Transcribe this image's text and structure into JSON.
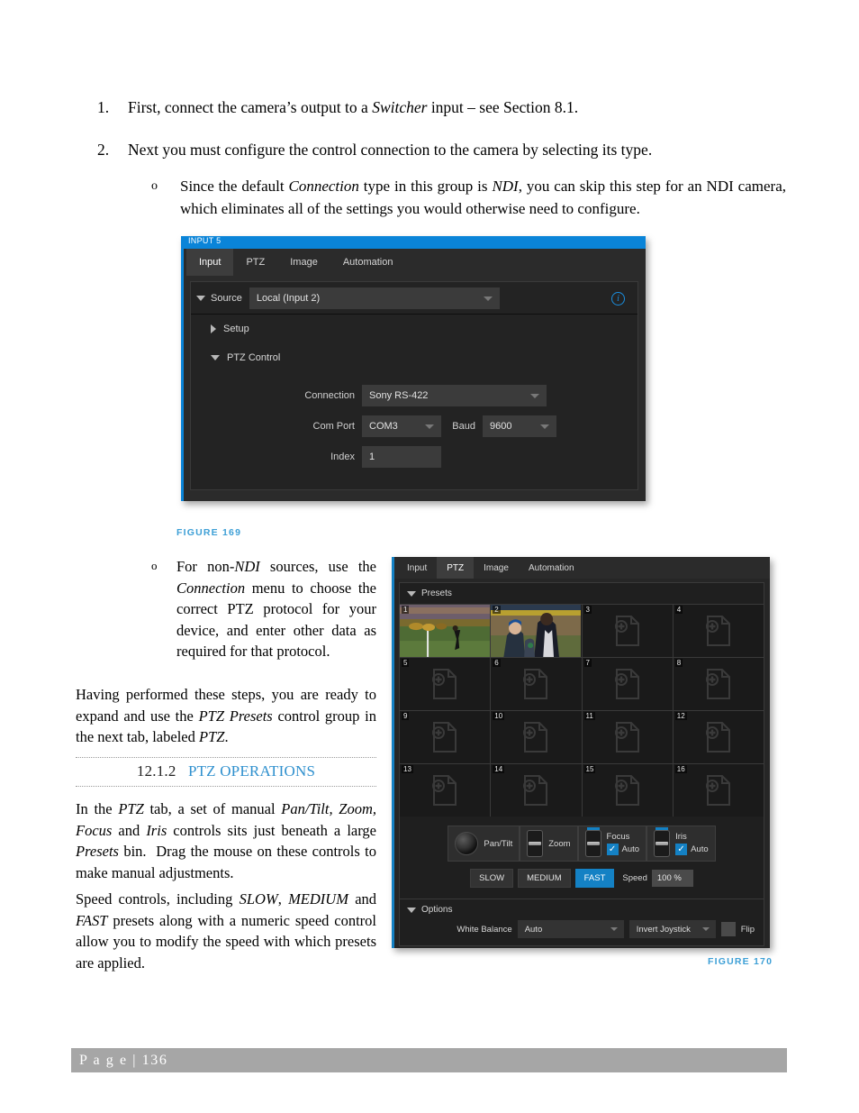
{
  "document": {
    "page_label": "P a g e  | 136",
    "steps": [
      {
        "marker": "1.",
        "text_html": "First, connect the camera’s output to a <em>Switcher</em> input – see Section 8.1."
      },
      {
        "marker": "2.",
        "text_html": "Next you must configure the control connection to the camera by selecting its type."
      }
    ],
    "bullet_1": {
      "marker": "o",
      "text_html": "Since the default <em>Connection</em> type in this group is <em>NDI</em>, you can skip this step for an NDI camera, which eliminates all of the settings you would otherwise need to configure."
    },
    "bullet_2": {
      "marker": "o",
      "text_html": "For non-<em>NDI</em> sources, use the <em>Connection</em> menu to choose the correct PTZ protocol for your device, and enter other data as required for that protocol."
    },
    "paragraphs": [
      {
        "id": "p_having",
        "text_html": "Having performed these steps, you are ready to expand and use the <em>PTZ Presets</em> control group in the next tab, labeled <em>PTZ</em>."
      },
      {
        "id": "p_inthe",
        "text_html": "In the <em>PTZ</em> tab, a set of manual <em>Pan/Tilt, Zoom, Focus</em> and <em>Iris</em> controls sits just beneath a large <em>Presets</em> bin.&nbsp; Drag the mouse on these controls to make manual adjustments."
      },
      {
        "id": "p_speed",
        "text_html": "Speed controls, including <em>SLOW</em>, <em>MEDIUM</em> and <em>FAST</em> presets along with a numeric speed control allow you to modify the speed with which presets are applied."
      }
    ],
    "section_heading": {
      "number": "12.1.2",
      "title": "PTZ OPERATIONS"
    },
    "captions": {
      "figure_169": "FIGURE 169",
      "figure_170": "FIGURE 170"
    }
  },
  "colors": {
    "accent_blue": "#1481c4",
    "titlebar_blue": "#0a84d8",
    "caption_blue": "#3d9fd6",
    "heading_blue": "#2f90ce",
    "panel_bg": "#2b2b2b",
    "footer_gray": "#a6a6a6"
  },
  "figure_169": {
    "window_title": "INPUT 5",
    "tabs": [
      {
        "label": "Input",
        "active": true
      },
      {
        "label": "PTZ",
        "active": false
      },
      {
        "label": "Image",
        "active": false
      },
      {
        "label": "Automation",
        "active": false
      }
    ],
    "source": {
      "label": "Source",
      "value": "Local (Input 2)"
    },
    "info_icon": "info-icon",
    "groups": [
      {
        "label": "Setup",
        "expanded": false
      },
      {
        "label": "PTZ Control",
        "expanded": true
      }
    ],
    "ptz_control": {
      "connection": {
        "label": "Connection",
        "value": "Sony RS-422"
      },
      "com_port": {
        "label": "Com Port",
        "value": "COM3"
      },
      "baud": {
        "label": "Baud",
        "value": "9600"
      },
      "index": {
        "label": "Index",
        "value": "1"
      }
    }
  },
  "figure_170": {
    "tabs": [
      {
        "label": "Input",
        "active": false
      },
      {
        "label": "PTZ",
        "active": true
      },
      {
        "label": "Image",
        "active": false
      },
      {
        "label": "Automation",
        "active": false
      }
    ],
    "presets": {
      "label": "Presets",
      "expanded": true,
      "slots": [
        {
          "number": "1",
          "filled": true
        },
        {
          "number": "2",
          "filled": true
        },
        {
          "number": "3",
          "filled": false
        },
        {
          "number": "4",
          "filled": false
        },
        {
          "number": "5",
          "filled": false
        },
        {
          "number": "6",
          "filled": false
        },
        {
          "number": "7",
          "filled": false
        },
        {
          "number": "8",
          "filled": false
        },
        {
          "number": "9",
          "filled": false
        },
        {
          "number": "10",
          "filled": false
        },
        {
          "number": "11",
          "filled": false
        },
        {
          "number": "12",
          "filled": false
        },
        {
          "number": "13",
          "filled": false
        },
        {
          "number": "14",
          "filled": false
        },
        {
          "number": "15",
          "filled": false
        },
        {
          "number": "16",
          "filled": false
        }
      ]
    },
    "manual_controls": {
      "pan_tilt": {
        "label": "Pan/Tilt"
      },
      "zoom": {
        "label": "Zoom"
      },
      "focus": {
        "label": "Focus",
        "auto_label": "Auto",
        "auto_checked": true
      },
      "iris": {
        "label": "Iris",
        "auto_label": "Auto",
        "auto_checked": true
      }
    },
    "speed": {
      "buttons": [
        {
          "label": "SLOW",
          "active": false
        },
        {
          "label": "MEDIUM",
          "active": false
        },
        {
          "label": "FAST",
          "active": true
        }
      ],
      "label": "Speed",
      "value": "100 %"
    },
    "options": {
      "label": "Options",
      "expanded": true,
      "white_balance": {
        "label": "White Balance",
        "value": "Auto"
      },
      "invert_joystick": {
        "value": "Invert Joystick"
      },
      "flip": {
        "label": "Flip",
        "checked": false
      }
    }
  }
}
